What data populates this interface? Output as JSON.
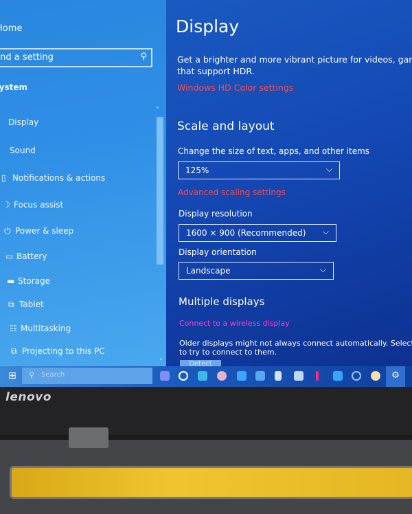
{
  "sidebar": {
    "home": "Home",
    "search_placeholder": "Find a setting",
    "section": "System",
    "items": [
      {
        "label": "Display",
        "icon": "monitor-icon",
        "glyph": ""
      },
      {
        "label": "Sound",
        "icon": "speaker-icon",
        "glyph": ""
      },
      {
        "label": "Notifications & actions",
        "icon": "notification-icon",
        "glyph": "▯"
      },
      {
        "label": "Focus assist",
        "icon": "moon-icon",
        "glyph": "☽"
      },
      {
        "label": "Power & sleep",
        "icon": "power-icon",
        "glyph": "⏻"
      },
      {
        "label": "Battery",
        "icon": "battery-icon",
        "glyph": "▭"
      },
      {
        "label": "Storage",
        "icon": "storage-icon",
        "glyph": "▬"
      },
      {
        "label": "Tablet",
        "icon": "tablet-icon",
        "glyph": "⧉"
      },
      {
        "label": "Multitasking",
        "icon": "multitasking-icon",
        "glyph": "☷"
      },
      {
        "label": "Projecting to this PC",
        "icon": "projecting-icon",
        "glyph": "⧉"
      }
    ]
  },
  "main": {
    "title": "Display",
    "hdr_text_1": "Get a brighter and more vibrant picture for videos, games and apps",
    "hdr_text_2": "that support HDR.",
    "hdr_link": "Windows HD Color settings",
    "scale_heading": "Scale and layout",
    "scale_label": "Change the size of text, apps, and other items",
    "scale_value": "125%",
    "advanced_link": "Advanced scaling settings",
    "resolution_label": "Display resolution",
    "resolution_value": "1600 × 900 (Recommended)",
    "orientation_label": "Display orientation",
    "orientation_value": "Landscape",
    "multi_heading": "Multiple displays",
    "wireless_link": "Connect to a wireless display",
    "older_text_1": "Older displays might not always connect automatically. Select Detect",
    "older_text_2": "to try to connect to them.",
    "detect_button": "Detect"
  },
  "taskbar": {
    "search_placeholder": "Search"
  },
  "laptop": {
    "brand": "lenovo"
  },
  "colors": {
    "link_red": "#ff4a4a",
    "link_magenta": "#ff3fd6"
  }
}
